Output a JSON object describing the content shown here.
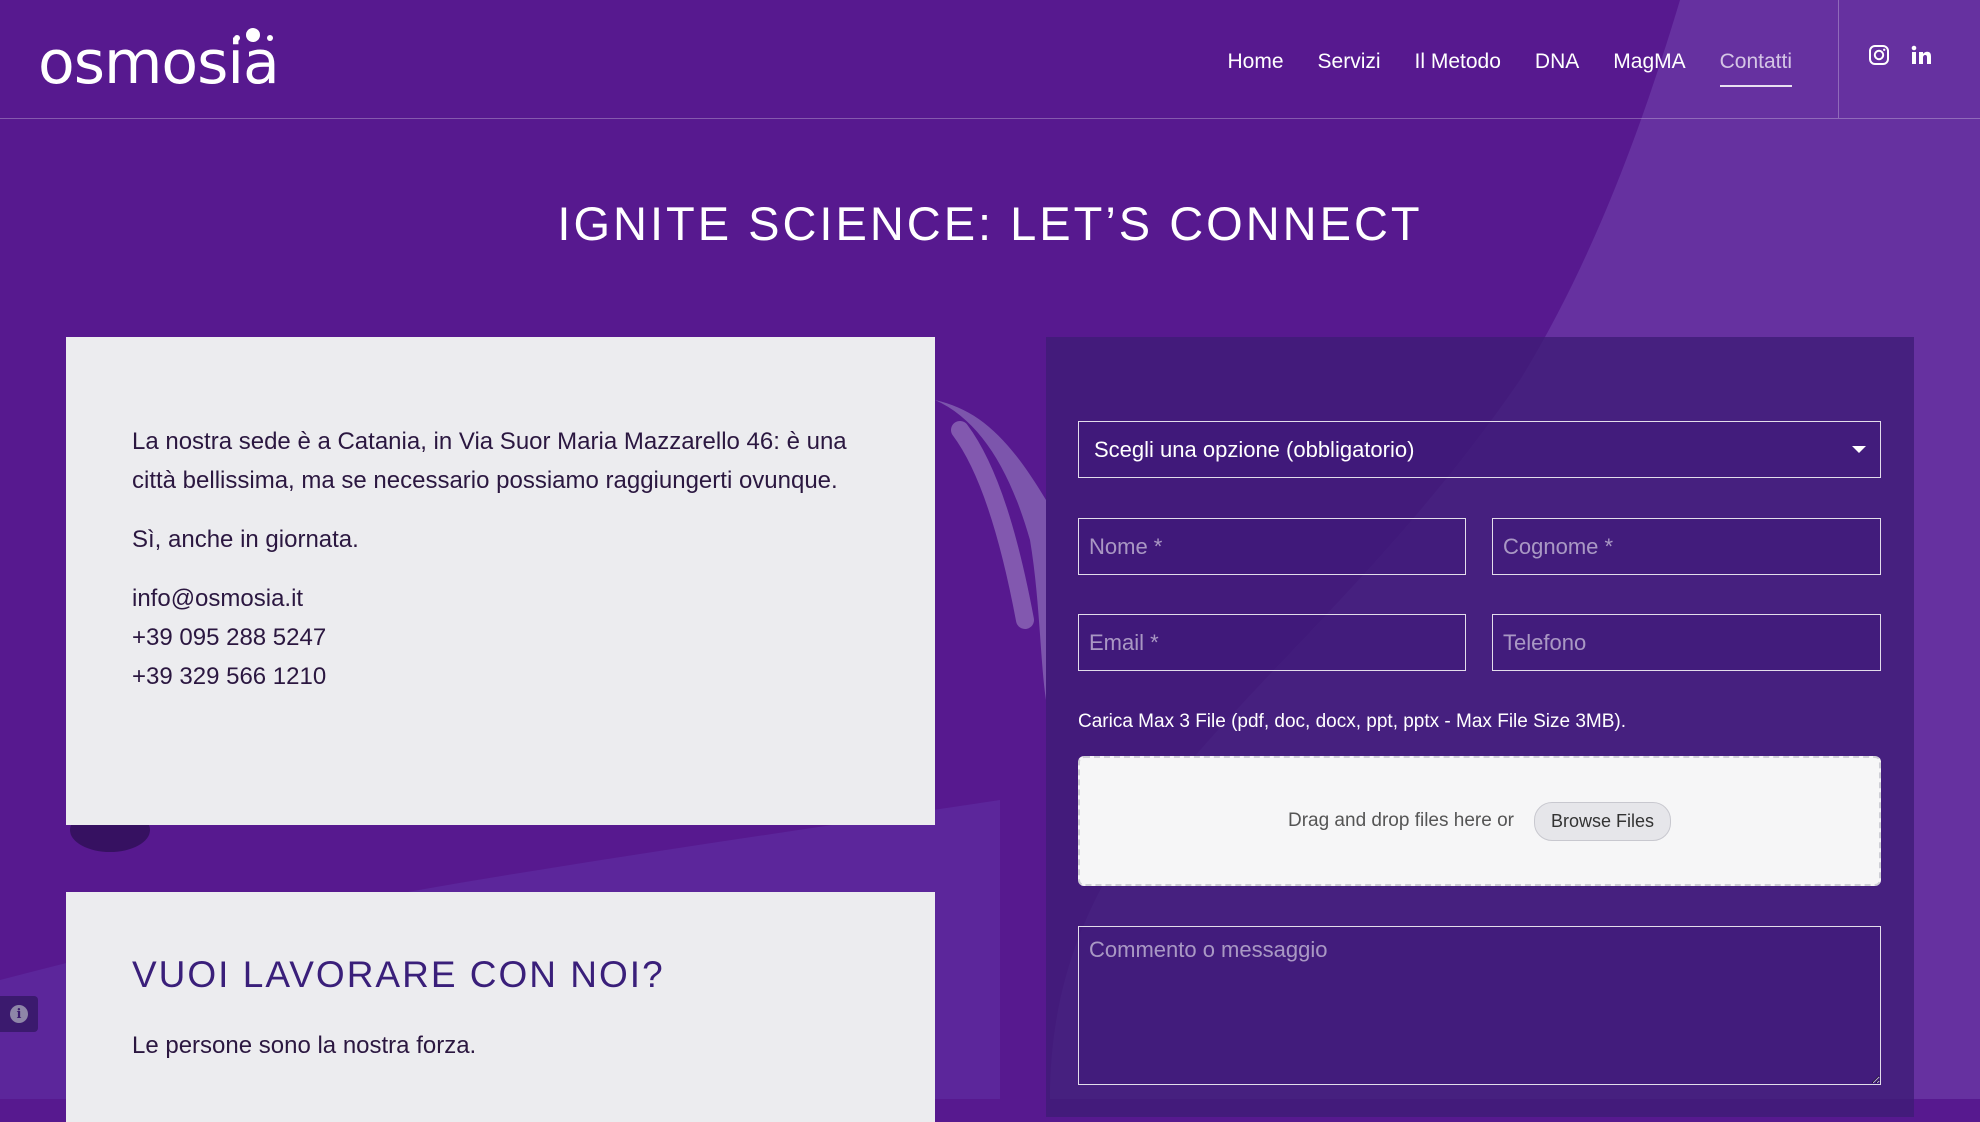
{
  "brand": {
    "logo_text": "osmosia"
  },
  "nav": {
    "items": [
      "Home",
      "Servizi",
      "Il Metodo",
      "DNA",
      "MagMA",
      "Contatti"
    ],
    "active": "Contatti"
  },
  "social": [
    "instagram-icon",
    "linkedin-icon"
  ],
  "page": {
    "title": "IGNITE SCIENCE: LET’S CONNECT"
  },
  "info_card": {
    "paragraph": "La nostra sede è a Catania, in Via Suor Maria Mazzarello 46: è una città bellissima, ma se necessario possiamo raggiungerti ovunque.",
    "line2": "Sì, anche in giornata.",
    "email": "info@osmosia.it",
    "phone1": "+39 095 288 5247",
    "phone2": "+39 329 566 1210"
  },
  "jobs_card": {
    "title": "VUOI LAVORARE CON NOI?",
    "text": "Le persone sono la nostra forza."
  },
  "form": {
    "select_label": "Scegli una opzione (obbligatorio)",
    "nome_placeholder": "Nome *",
    "cognome_placeholder": "Cognome *",
    "email_placeholder": "Email *",
    "telefono_placeholder": "Telefono",
    "upload_note": "Carica Max 3 File (pdf, doc, docx, ppt, pptx - Max File Size 3MB).",
    "dropzone_text": "Drag and drop files here or",
    "browse_label": "Browse Files",
    "message_placeholder": "Commento o messaggio"
  },
  "colors": {
    "background": "#57198f",
    "card": "#ececef",
    "heading_accent": "#3a1f7a",
    "form_panel": "#3e1c76"
  }
}
